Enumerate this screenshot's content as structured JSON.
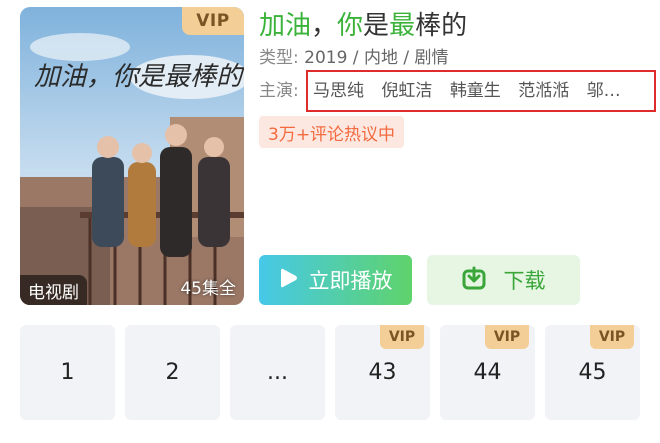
{
  "poster": {
    "vip_badge": "VIP",
    "type_tag": "电视剧",
    "episodes_tag": "45集全",
    "calligraphy": "加油，你是最棒的"
  },
  "title": {
    "part1": "加油",
    "part2": "，",
    "part3": "你",
    "part4": "是",
    "part5": "最",
    "part6": "棒的"
  },
  "meta": {
    "label": "类型:",
    "value": "2019 / 内地 / 剧情"
  },
  "cast": {
    "label": "主演:",
    "members": [
      "马思纯",
      "倪虹洁",
      "韩童生",
      "范湉湉",
      "邬…"
    ]
  },
  "hot_tag": "3万+评论热议中",
  "actions": {
    "play_label": "立即播放",
    "download_label": "下载"
  },
  "episodes": [
    {
      "label": "1",
      "vip": ""
    },
    {
      "label": "2",
      "vip": ""
    },
    {
      "label": "...",
      "vip": ""
    },
    {
      "label": "43",
      "vip": "VIP"
    },
    {
      "label": "44",
      "vip": "VIP"
    },
    {
      "label": "45",
      "vip": "VIP"
    }
  ],
  "colors": {
    "brand_green": "#3bb33a",
    "vip_gold": "#f3cf97",
    "highlight_red": "#e02b2b",
    "hot_orange": "#f26a3f"
  }
}
